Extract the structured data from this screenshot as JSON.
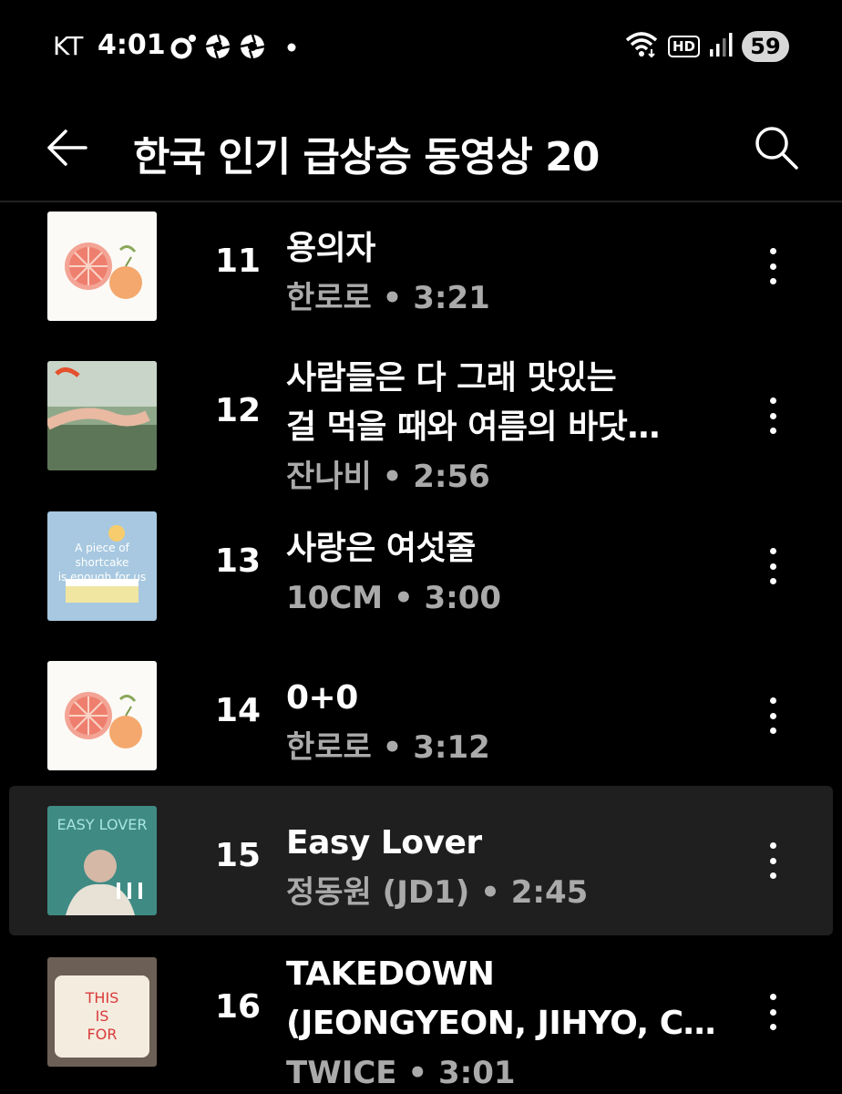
{
  "status_bar": {
    "carrier": "KT",
    "time": "4:01",
    "hd_label": "HD",
    "battery": "59"
  },
  "header": {
    "title": "한국 인기 급상승 동영상 20",
    "back_icon": "arrow-left-icon",
    "search_icon": "search-icon"
  },
  "tracks": [
    {
      "rank": "11",
      "title_lines": [
        "용의자"
      ],
      "artist": "한로로",
      "duration": "3:21",
      "sep": " • ",
      "art": "grapefruit"
    },
    {
      "rank": "12",
      "title_lines": [
        "사람들은 다 그래 맛있는",
        "걸 먹을 때와 여름의 바닷…"
      ],
      "artist": "잔나비",
      "duration": "2:56",
      "sep": " • ",
      "art": "hands"
    },
    {
      "rank": "13",
      "title_lines": [
        "사랑은 여섯줄"
      ],
      "artist": "10CM",
      "duration": "3:00",
      "sep": " • ",
      "art": "shortcake",
      "art_text": [
        "A piece of",
        "shortcake",
        "is enough for us"
      ]
    },
    {
      "rank": "14",
      "title_lines": [
        "0+0"
      ],
      "artist": "한로로",
      "duration": "3:12",
      "sep": " • ",
      "art": "grapefruit"
    },
    {
      "rank": "15",
      "title_lines": [
        "Easy Lover"
      ],
      "artist": "정동원 (JD1)",
      "duration": "2:45",
      "sep": " • ",
      "art": "easy-lover",
      "art_text": [
        "EASY LOVER"
      ],
      "playing": true
    },
    {
      "rank": "16",
      "title_lines": [
        "TAKEDOWN",
        "(JEONGYEON, JIHYO, C…"
      ],
      "artist": "TWICE",
      "duration": "3:01",
      "sep": " • ",
      "art": "cake",
      "art_text": [
        "THIS",
        "IS",
        "FOR"
      ]
    }
  ],
  "colors": {
    "background": "#000000",
    "active_row": "#1f1f1f",
    "secondary_text": "#aaaaaa"
  }
}
